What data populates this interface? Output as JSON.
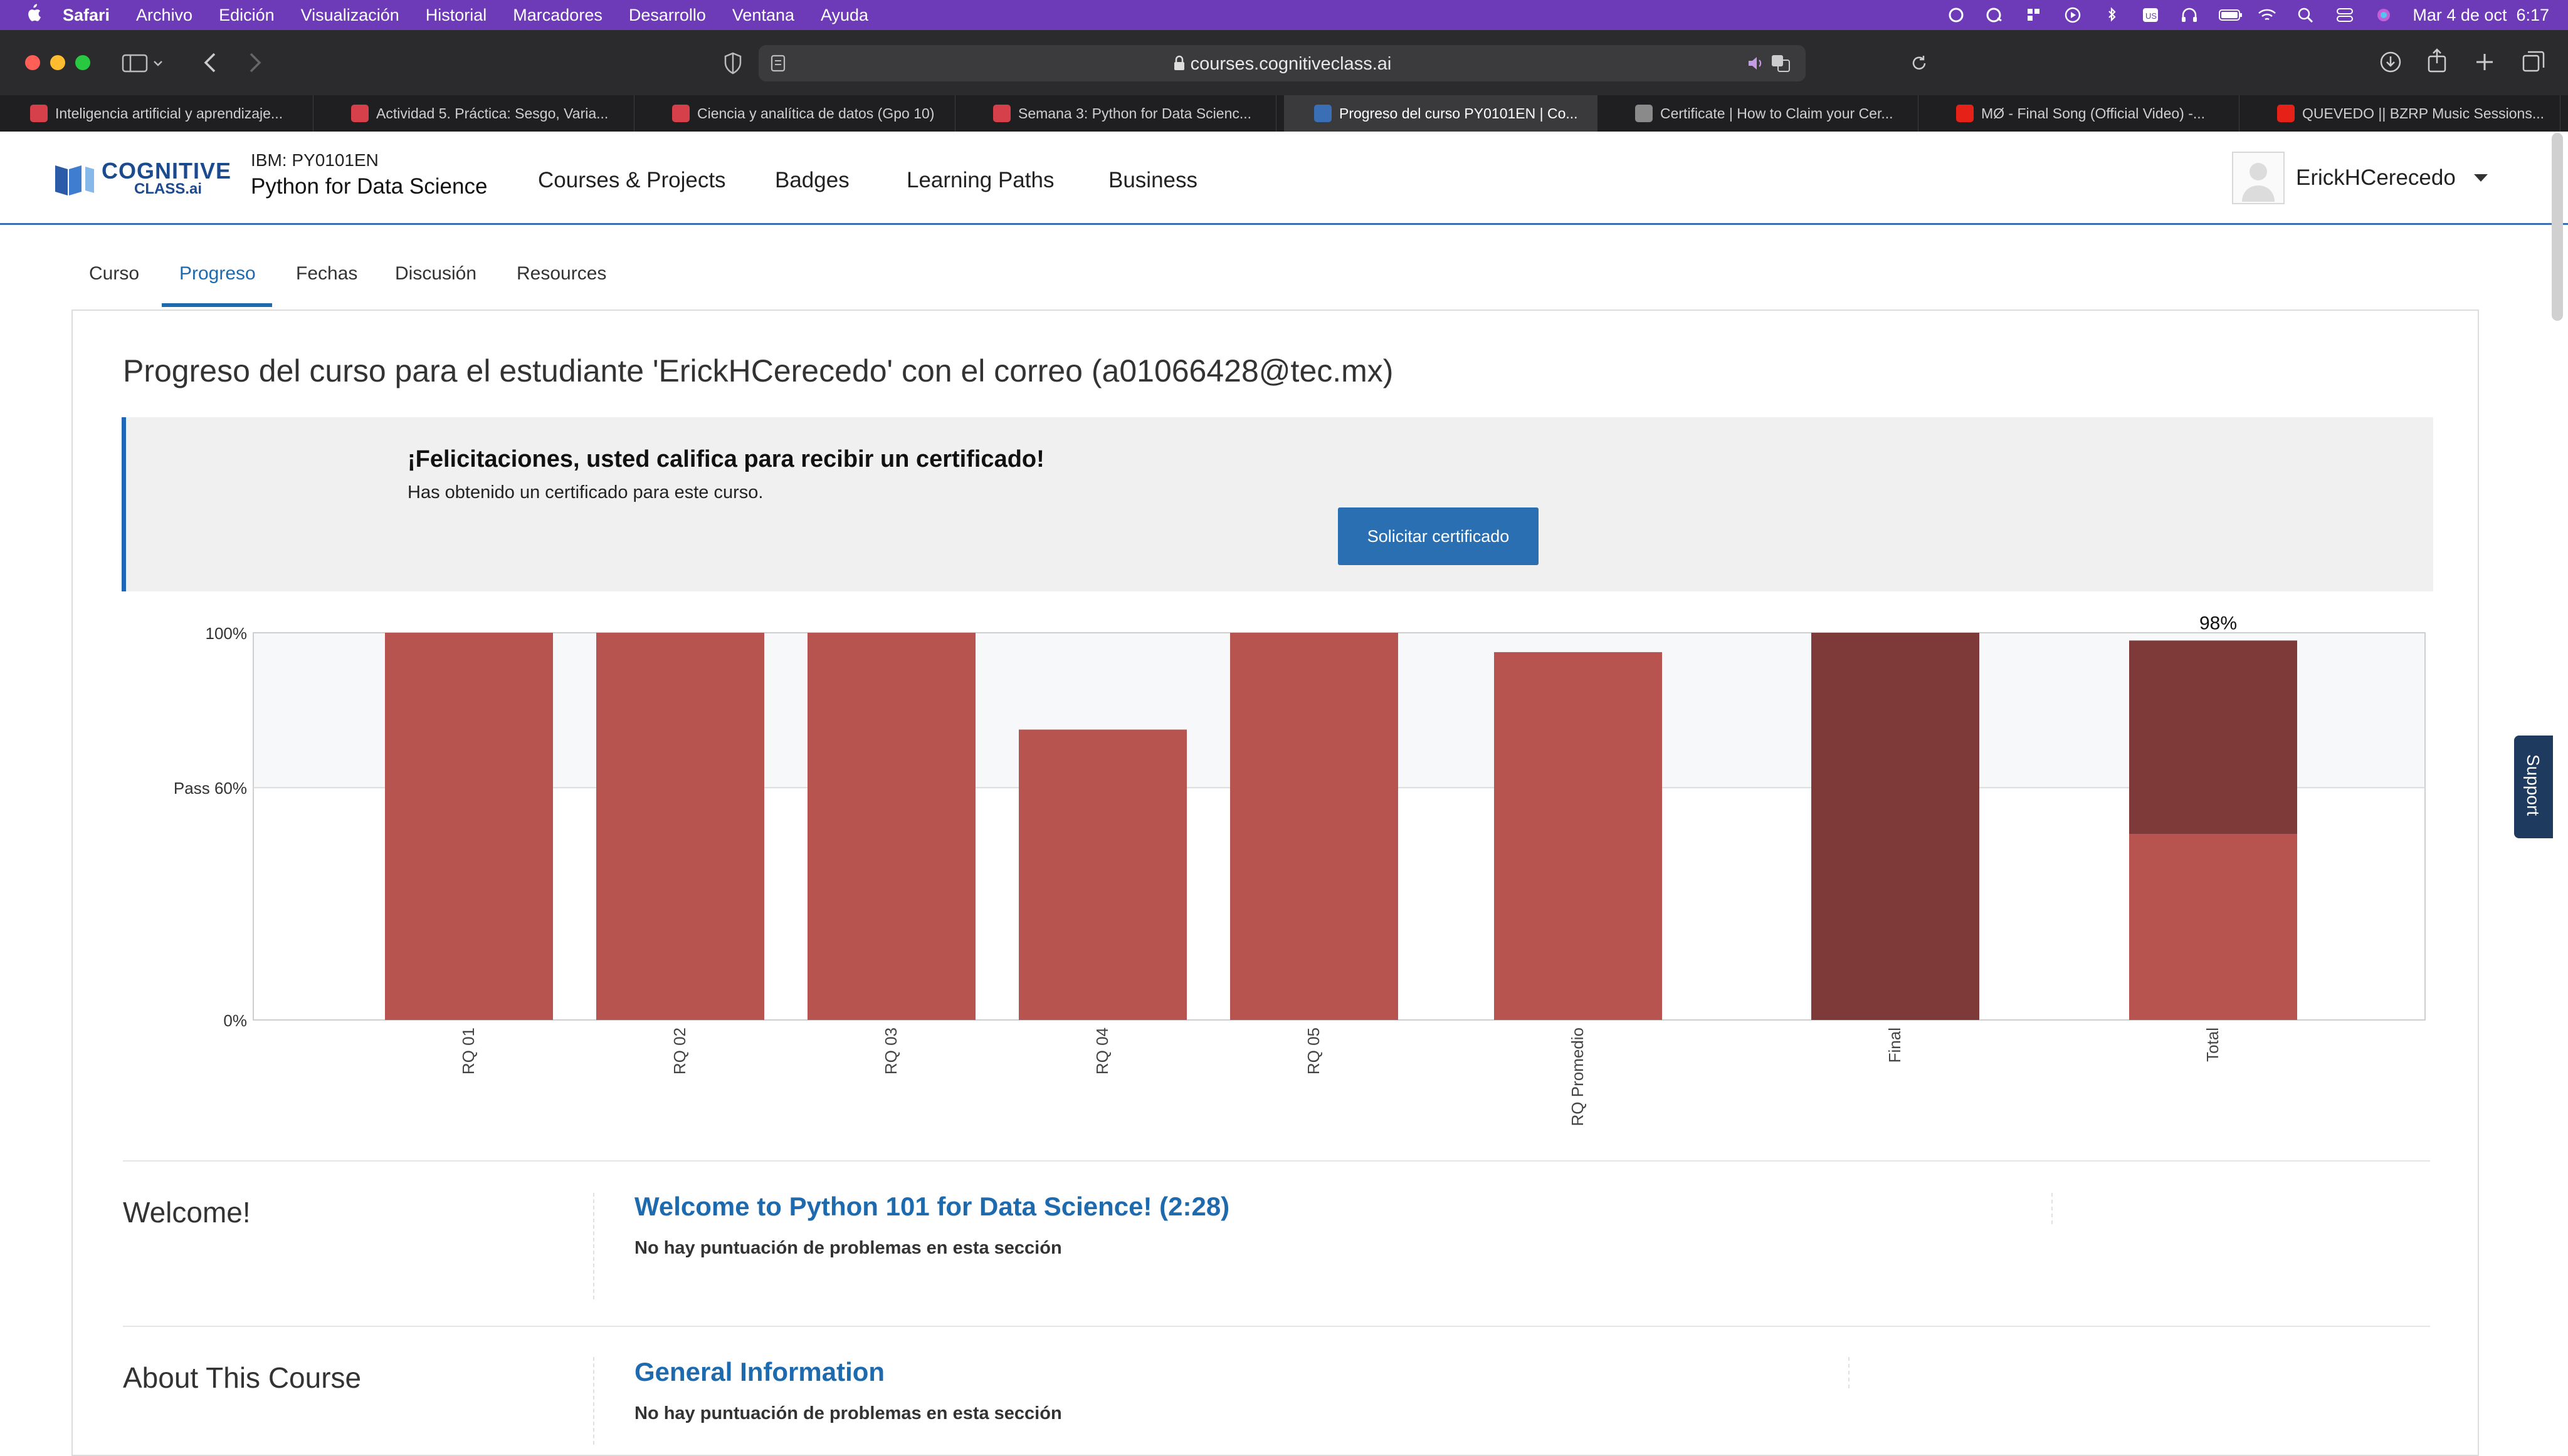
{
  "menubar": {
    "apple": "",
    "app": "Safari",
    "items": [
      "Archivo",
      "Edición",
      "Visualización",
      "Historial",
      "Marcadores",
      "Desarrollo",
      "Ventana",
      "Ayuda"
    ],
    "clock": "Mar 4 de oct  6:17"
  },
  "browser": {
    "url": "courses.cognitiveclass.ai",
    "tabs": [
      {
        "label": "Inteligencia artificial y aprendizaje...",
        "active": false
      },
      {
        "label": "Actividad 5. Práctica: Sesgo, Varia...",
        "active": false
      },
      {
        "label": "Ciencia y analítica de datos (Gpo 10)",
        "active": false
      },
      {
        "label": "Semana 3: Python for Data Scienc...",
        "active": false
      },
      {
        "label": "Progreso del curso PY0101EN | Co...",
        "active": true
      },
      {
        "label": "Certificate | How to Claim your Cer...",
        "active": false
      },
      {
        "label": "MØ - Final Song (Official Video) -...",
        "active": false
      },
      {
        "label": "QUEVEDO || BZRP Music Sessions...",
        "active": false
      }
    ]
  },
  "site": {
    "logo_line1": "COGNITIVE",
    "logo_line2": "CLASS.ai",
    "course_code": "IBM: PY0101EN",
    "course_title": "Python for Data Science",
    "nav": [
      "Courses & Projects",
      "Badges",
      "Learning Paths",
      "Business"
    ],
    "username": "ErickHCerecedo"
  },
  "course_tabs": [
    "Curso",
    "Progreso",
    "Fechas",
    "Discusión",
    "Resources"
  ],
  "progress": {
    "heading": "Progreso del curso para el estudiante 'ErickHCerecedo' con el correo (a01066428@tec.mx)",
    "cert_title": "¡Felicitaciones, usted califica para recibir un certificado!",
    "cert_subtitle": "Has obtenido un certificado para este curso.",
    "cert_button": "Solicitar certificado"
  },
  "chart_data": {
    "type": "bar",
    "categories": [
      "RQ 01",
      "RQ 02",
      "RQ 03",
      "RQ 04",
      "RQ 05",
      "RQ Promedio",
      "Final",
      "Total"
    ],
    "values": [
      100,
      100,
      100,
      75,
      100,
      95,
      100,
      98
    ],
    "total_split": {
      "lower": 48,
      "upper": 50
    },
    "total_label": "98%",
    "y_ticks": [
      "0%",
      "Pass 60%",
      "100%"
    ],
    "ylim": [
      0,
      100
    ],
    "pass_line": 60,
    "colors": {
      "bar": "#b85450",
      "dark": "#7e3a38",
      "band": "#f7f8fa"
    }
  },
  "sections": [
    {
      "title": "Welcome!",
      "link": "Welcome to Python 101 for Data Science! (2:28)",
      "note": "No hay puntuación de problemas en esta sección"
    },
    {
      "title": "About This Course",
      "link": "General Information",
      "note": "No hay puntuación de problemas en esta sección"
    }
  ],
  "support": "Support"
}
